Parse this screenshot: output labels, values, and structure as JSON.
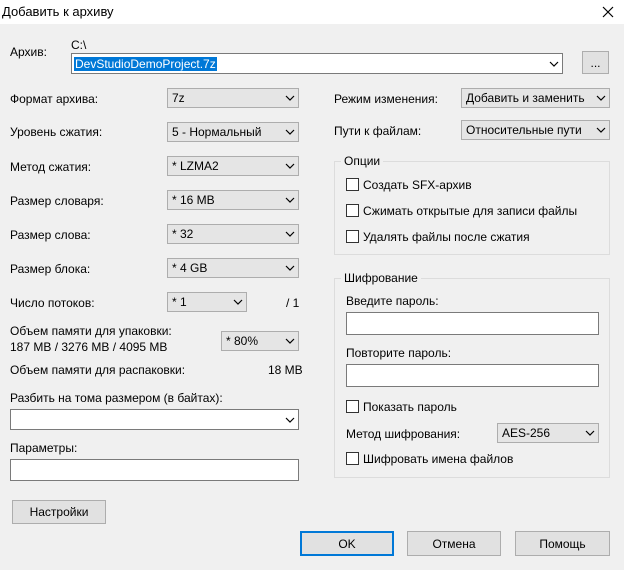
{
  "window": {
    "title": "Добавить к архиву"
  },
  "archive": {
    "label": "Архив:",
    "path": "C:\\",
    "filename": "DevStudioDemoProject.7z",
    "browse_label": "..."
  },
  "left": {
    "format_label": "Формат архива:",
    "format_value": "7z",
    "level_label": "Уровень сжатия:",
    "level_value": "5 - Нормальный",
    "method_label": "Метод сжатия:",
    "method_value": "*  LZMA2",
    "dict_label": "Размер словаря:",
    "dict_value": "*  16 MB",
    "word_label": "Размер слова:",
    "word_value": "*  32",
    "block_label": "Размер блока:",
    "block_value": "*  4 GB",
    "threads_label": "Число потоков:",
    "threads_value": "*  1",
    "threads_max": "/ 1",
    "mem_pack_label": "Объем памяти для упаковки:",
    "mem_pack_values": "187 MB / 3276 MB / 4095 MB",
    "mem_pack_percent": "* 80%",
    "mem_unpack_label": "Объем памяти для распаковки:",
    "mem_unpack_value": "18 MB",
    "split_label": "Разбить на тома размером (в байтах):",
    "split_value": "",
    "params_label": "Параметры:",
    "params_value": "",
    "settings_button": "Настройки"
  },
  "right": {
    "update_label": "Режим изменения:",
    "update_value": "Добавить и заменить",
    "paths_label": "Пути к файлам:",
    "paths_value": "Относительные пути",
    "options": {
      "title": "Опции",
      "sfx": "Создать SFX-архив",
      "shared": "Сжимать открытые для записи файлы",
      "delete": "Удалять файлы после сжатия"
    },
    "encryption": {
      "title": "Шифрование",
      "password_label": "Введите пароль:",
      "repeat_label": "Повторите пароль:",
      "show_password": "Показать пароль",
      "method_label": "Метод шифрования:",
      "method_value": "AES-256",
      "encrypt_names": "Шифровать имена файлов"
    }
  },
  "buttons": {
    "ok": "OK",
    "cancel": "Отмена",
    "help": "Помощь"
  },
  "icons": {
    "close": "close-icon",
    "dropdown": "chevron-down-icon"
  }
}
